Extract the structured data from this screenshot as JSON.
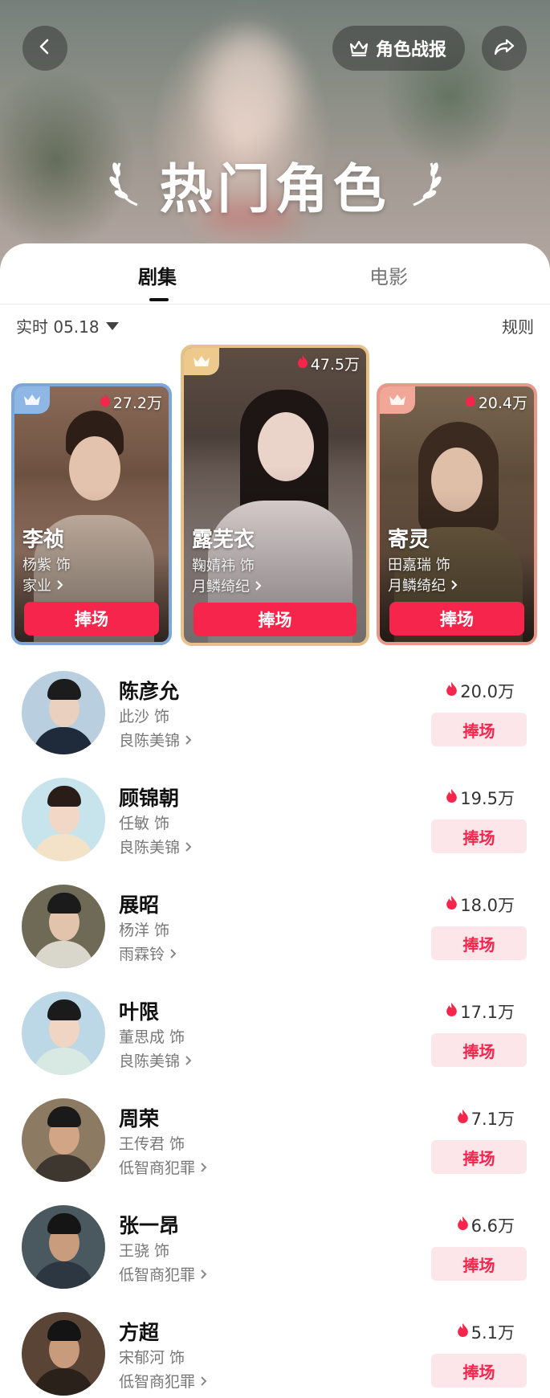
{
  "header": {
    "report_label": "角色战报",
    "title": "热门角色"
  },
  "tabs": [
    {
      "label": "剧集",
      "active": true
    },
    {
      "label": "电影",
      "active": false
    }
  ],
  "filter": {
    "time_label": "实时 05.18",
    "rules_label": "规则"
  },
  "top3": [
    {
      "rank": 2,
      "heat": "27.2万",
      "name": "李祯",
      "actor": "杨紫 饰",
      "drama": "家业",
      "cheer": "捧场"
    },
    {
      "rank": 1,
      "heat": "47.5万",
      "name": "露芜衣",
      "actor": "鞠婧祎 饰",
      "drama": "月鳞绮纪",
      "cheer": "捧场"
    },
    {
      "rank": 3,
      "heat": "20.4万",
      "name": "寄灵",
      "actor": "田嘉瑞 饰",
      "drama": "月鳞绮纪",
      "cheer": "捧场"
    }
  ],
  "list": [
    {
      "name": "陈彦允",
      "actor": "此沙 饰",
      "drama": "良陈美锦",
      "heat": "20.0万",
      "cheer": "捧场"
    },
    {
      "name": "顾锦朝",
      "actor": "任敏 饰",
      "drama": "良陈美锦",
      "heat": "19.5万",
      "cheer": "捧场"
    },
    {
      "name": "展昭",
      "actor": "杨洋 饰",
      "drama": "雨霖铃",
      "heat": "18.0万",
      "cheer": "捧场"
    },
    {
      "name": "叶限",
      "actor": "董思成 饰",
      "drama": "良陈美锦",
      "heat": "17.1万",
      "cheer": "捧场"
    },
    {
      "name": "周荣",
      "actor": "王传君 饰",
      "drama": "低智商犯罪",
      "heat": "7.1万",
      "cheer": "捧场"
    },
    {
      "name": "张一昂",
      "actor": "王骁 饰",
      "drama": "低智商犯罪",
      "heat": "6.6万",
      "cheer": "捧场"
    },
    {
      "name": "方超",
      "actor": "宋郁河 饰",
      "drama": "低智商犯罪",
      "heat": "5.1万",
      "cheer": "捧场"
    }
  ],
  "colors": {
    "accent": "#f5254c",
    "cheer_soft_bg": "#fde6ea",
    "rank1_border": "#e6c28a",
    "rank2_border": "#7ea7d8",
    "rank3_border": "#e8988a"
  }
}
